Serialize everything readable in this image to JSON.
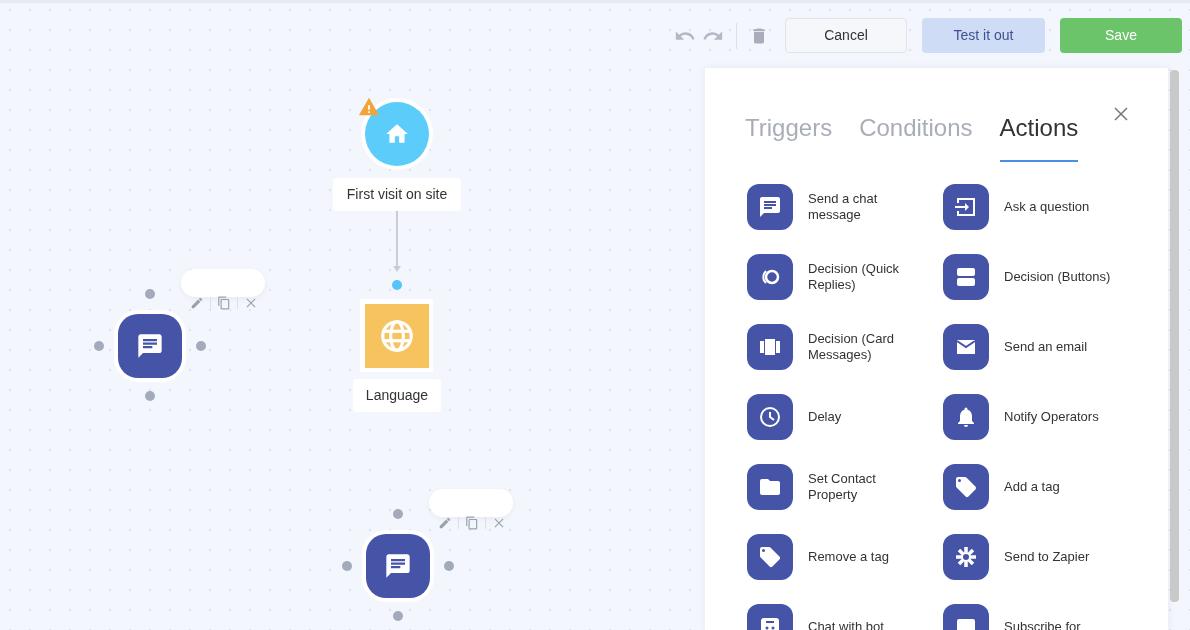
{
  "toolbar": {
    "buttons": [
      {
        "kind": "undo"
      },
      {
        "kind": "redo"
      },
      {
        "kind": "delete"
      },
      {
        "kind": "cancel",
        "label": "Cancel"
      },
      {
        "kind": "test",
        "label": "Test it out"
      },
      {
        "kind": "save",
        "label": "Save"
      }
    ]
  },
  "canvas": {
    "nodes": [
      {
        "kind": "trigger",
        "label": "First visit on site",
        "warning": true
      },
      {
        "kind": "language",
        "label": "Language"
      },
      {
        "kind": "message",
        "toolbar": true
      },
      {
        "kind": "message",
        "toolbar": true
      }
    ]
  },
  "panel": {
    "tabs": [
      {
        "label": "Triggers",
        "selected": false
      },
      {
        "label": "Conditions",
        "selected": false
      },
      {
        "label": "Actions",
        "selected": true
      }
    ],
    "actions": [
      {
        "label": "Send a chat message"
      },
      {
        "label": "Ask a question"
      },
      {
        "label": "Decision (Quick Replies)"
      },
      {
        "label": "Decision (Buttons)"
      },
      {
        "label": "Decision (Card Messages)"
      },
      {
        "label": "Send an email"
      },
      {
        "label": "Delay"
      },
      {
        "label": "Notify Operators"
      },
      {
        "label": "Set Contact Property"
      },
      {
        "label": "Add a tag"
      },
      {
        "label": "Remove a tag"
      },
      {
        "label": "Send to Zapier"
      },
      {
        "label": "Chat with bot"
      },
      {
        "label": "Subscribe for"
      }
    ]
  }
}
